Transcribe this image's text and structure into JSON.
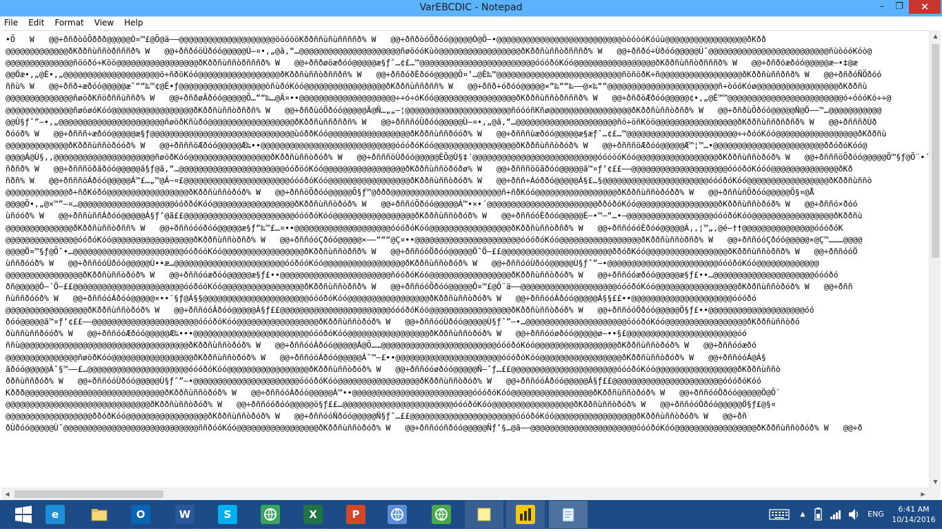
{
  "window": {
    "title": "VarEBCDIC - Notepad",
    "minimize": "–",
    "maximize": "❐",
    "close": "✕"
  },
  "menu": [
    "File",
    "Edit",
    "Format",
    "View",
    "Help"
  ],
  "editor_lines": [
    "•Õ   W   @@÷ðñðòôÕððð@@@@@Ò¤™£@Õ@ä——@@@@@@@@@@@@@@@@@@@@ööóööKððññùñùññññð% W   @@÷ðñðòóÕðóó@@@@@Ò@Õ–•@@@@@@@@@@@@@@@@@@@@@@@@@@òòóòóKóúù@@@@@@@@@@@@@@@@@ðKðð",
    "@@@@@@@@@@@@@ðKððñùññòðñññð% W   @@÷ðñðóöÙðóó@@@@@Ù–¤•,„@ã,“…@@@@@@@@@@@@@@@@@@@@@ñøöóóKùò@@@@@@@@@@@@@@@@@ðKððñùññòðñññð% W   @@÷ðñðó÷Ùðóó@@@@@Ùˆ@@@@@@@@@@@@@@@@@@@@@@@@@ñùòóóKóò@",
    "@@@@@@@@@@@@@@ñööðó÷Köö@@@@@@@@@@@@@@@@@ðKððñùññòðñññð% W   @@÷ðñðøöæðóó@@@@@æ§ƒˆ…¢£…™@@@@@@@@@@@@@@@@@@@@@@@@óóóðóKóó@@@@@@@@@@@@@@@@@ðKððñùññòðñññð% W   @@÷ðñðóæðóó@@@@@æ–•‡@æ",
    "@@Öæ•,„@È•,„@@@@@@@@@@@@@@@@@@@@ö÷ñðöKóó@@@@@@@@@@@@@@@@@ðKððñùññòðññðñ% W   @@÷ðñðóðÈðóó@@@@@Õ¤’…@È‰™@@@@@@@@@@@@@@@@@@@@@@@@@@ñöñöðK÷ñ@@@@@@@@@@@@@@@@@ðKððñùññðñð% W   @@÷ðñðóÑÕðóó",
    "ññù% W   @@÷ðñð÷æðóó@@@@@æˆ““‰™¢@É•ƒ@@@@@@@@@@@@@@@@@@òñùðóKóó@@@@@@@@@@@@@@@@@ðKððñùññðññ% W   @@÷ðñð÷óðóó@@@@@×“‰““‰——@×‰““@@@@@@@@@@@@@@@@@@@@@@@ñ÷òóóKóø@@@@@@@@@@@@@@@@@ðKððñù",
    "@@@@@@@@@@@@@@ñøöðKñöðññùññð% W   @@÷ðñðøÄðóó@@@@@Õ…““‰…@Ä¤••@@@@@@@@@@@@@@@@@@@@÷÷ó÷óKóó@@@@@@@@@@@@@@@@@ðKððñùññòðñññð% W   @@÷ðñðöÆðóó@@@@@¢•,„@É™™@@@@@@@@@@@@@@@@@@@@@@@@ó÷óóóKó÷÷@",
    "@@@@@@@@@@@@@@ñøöøóKóó@@@@@@@@@@@@@@@@@ðKððñùññòðñðñ% W   @@÷ðñðùóÕðóó@@@@@Ã@Ñ…„„—¦@@@@@@@@@@@@@@@@@@@@@@ñóóóñKñø@@@@@@@@@@@@@@@@@ðKððñùññòðñð% W   @@÷ðñðùÕðóó@@@@@Ñ@Ö——™…@@@@@@@@@@@",
    "@@Ù§ƒˆ”—•,„@@@@@@@@@@@@@@@@@@@@@@ñøöðKñùðó@@@@@@@@@@@@@@@@@@ðKððñùññðñðñ% W   @@÷ðñññóÙðóó@@@@@Ù–¤•,„@ã,“…@@@@@@@@@@@@@@@@@@@@@ñö÷öñKöö@@@@@@@@@@@@@@@@@ðKððñùññðñðñð% W   @@÷ðñññðÙð",
    "ðóóð% W   @@÷ðñññ÷æðóó@@@@@æ§ƒ@@@@@@@@@@@@@@@@@@@@@@@@@@@@@@ùóððKóó@@@@@@@@@@@@@@@@@ðKððñùññðóóð% W   @@÷ðñññùæðóó@@@@@æ§æƒˆ…¢£…™@@@@@@@@@@@@@@@@@@@@@@@÷÷ðóóKóó@@@@@@@@@@@@@@@@@ðKððñù",
    "@@@@@@@@@@@@@ðKððñùññòðóóð% W   @@÷ðñññöÆðóó@@@@@Æ‰••@@@@@@@@@@@@@@@@@@@@@@@@@@@@óóóðóKóó@@@@@@@@@@@@@@@@@ðKððñùññòðóð% W   @@÷ðñññöÆðóó@@@@@Æ™¦™…•@@@@@@@@@@@@@@@@@@@@@@@ððóðóKóó@",
    "@@@@Á@Ù§,,@@@@@@@@@@@@@@@@@@@@@ñøöðKóó@@@@@@@@@@@@@@@@@ðKððñùññòðóð% W   @@÷ðñññöÙðóó@@@@@ÈÕ@Ù§‡´@@@@@@@@@@@@@@@@@@@@@@@@@@óóóöóKóó@@@@@@@@@@@@@@@@@ðKððñùññòðóð% W   @@÷ðñññöÕðóó@@@@@Õ™§ƒ@Õ¨•´@",
    "ñðñð% W   @@÷ðñññöðãðóó@@@@@ã§ƒ@ã,“…@@@@@@@@@@@@@@@@@@@@@@óóðöóKóó@@@@@@@@@@@@@@@@@ðKððñùññòðóðø% W   @@÷ðñññööãðóó@@@@@ã™¤ƒ’¢££——@@@@@@@@@@@@@@@@@@@@óóóðóKóóó@@@@@@@@@@@@@@ðKð",
    "ñðñ% W   @@÷ðñññöÁðóó@@@@@Á™£…„™@Á–¤£@@@@@@@@@@@@@@@@@@@@@@óóóðóKóó@@@@@@@@@@@@@@@@@ðKððñùññòðóð% W   @@÷ðññ÷Áóððó@@@@@Á§£…§@@@@@@@@@@@@@@@@@@@@@@óóóðóKóó@@@@@@@@@@@@@@@@@ðKððñùññò",
    "@@@@@@@@@@@@@ð÷ñðKóðó@@@@@@@@@@@@@@@@@ðKððñùññòðóð% W   @@÷ðññöÕðóó@@@@@Õ§ƒ™@ððð@@@@@@@@@@@@@@@@@@@@@@@ñ÷ñðKóó@@@@@@@@@@@@@@@@@ðKððñùññòðóðð% W   @@÷ðññùñÕðóó@@@@@Õ§¤@Å",
    "@@@@Õ•,„@×™”—¤…@@@@@@@@@@@@@@@@@@@@óóððóKóó@@@@@@@@@@@@@@@@@ðKððñùññòðóð% W   @@÷ðññóÕðóó@@@@@Á™•×•´@@@@@@@@@@@@@@@@@@@@@@@ððóðóKóó@@@@@@@@@@@@@@@@@ðKððñùññòðóð% W   @@÷ðññó×ðóó",
    "ùñóóð% W   @@÷ðññùññÁðóó@@@@@Á§ƒ’@ã££@@@@@@@@@@@@@@@@@@@@@@@óóóðóKóó@@@@@@@@@@@@@@@@@ðKððñùññòðóð% W   @@÷ðññóóÈðóó@@@@@È–•™—“…•—@@@@@@@@@@@@@@@@@@óóóðóKóó@@@@@@@@@@@@@@@@@ðKððñù",
    "@@@@@@@@@@@@@@ðKððñùññòðññ% W   @@÷ðññóóóðóó@@@@@æ§ƒ“‰™£…¤••@@@@@@@@@@@@@@@@@@@@óóóðóKóó@@@@@@@@@@@@@@@@@ðKððñùññòðñð% W   @@÷ðññóóóÈðóó@@@@@Á,,¦™„,@é–††@@@@@@@@@@@@@@@óóóðóK",
    "@@@@@@@@@@@@@@@óóðóKóó@@@@@@@@@@@@@@@@@ðKððñùññòðñð% W   @@÷ðññóóÇðóó@@@@@×–—“““@Ç¤••@@@@@@@@@@@@@@@@@@@@@@óóóðóKóó@@@@@@@@@@@@@@@@@ðKððñùññòðñð% W   @@÷ðññóóÇðóó@@@@@×@Ç™………@@@@",
    "@@@@Ö¤™§ƒ@Õˆ•…@@@@@@@@@@@@@@@@@@@@@@@óóðóóKóó@@@@@@@@@@@@@@@@@ðKððñùññòðñð% W   @@÷ðññóóÖðóó@@@@@ÖˆÖ–££@@@@@@@@@@@@@@@@@@@@@@@ððóðKóó@@@@@@@@@@@@@@@@@ðKððñùññòðñð% W   @@÷ðññóóÖ",
    "ùññðóóð% W   @@÷ðññóóÙðóó@@@@@Ù••æ…@@@@@@@@@@@@@@@@@@@@@@@óóðóóKóó@@@@@@@@@@@@@@@@@ðKððñùññòðóð% W   @@÷ðññóóÙðóó@@@@@Ù§ƒˆ”—•@@@@@@@@@@@@@@@@@@@@@@@óóóðóKóó@@@@@@@@@@@@@",
    "@@@@@@@@@@@@@@@@ðKððñùññòðóð% W   @@÷ðññóóæðóó@@@@@æ§ƒ£••@@@@@@@@@@@@@@@@@@@@@@@ñóóðóKóó@@@@@@@@@@@@@@@@@ðKððñùññòðóð% W   @@÷ðññóóæðóó@@@@@æ§ƒ£••…@@@@@@@@@@@@@@@@@@@@@óóóðó",
    "ðñ@@@@@Ö–´Ö–££@@@@@@@@@@@@@@@@@@@@@@@óóðóóKóó@@@@@@@@@@@@@@@@@ðKððñùññòðñð% W   @@÷ðññóóÕðóó@@@@@Õ¤™£@Õ¨ä——@@@@@@@@@@@@@@@@@@@@óóóðóKóó@@@@@@@@@@@@@@@@@ðKððñùññòðóð% W   @@÷ðññ",
    "ñùññðóóð% W   @@÷ðññóóÁðóó@@@@@×••¨§ƒ@Á§§@@@@@@@@@@@@@@@@@@@@@@óóóðóKóó@@@@@@@@@@@@@@@@@ðKððñùññòðóð% W   @@÷ðññóóÁðóó@@@@@Á§§££••@@@@@@@@@@@@@@@@@@@@@óóóðó",
    "@@@@@@@@@@@@@@@@@ðKððñùññòðóð% W   @@÷ðññóóÁðóó@@@@@Á§ƒ££@@@@@@@@@@@@@@@@@@@@@@@óóóðóKóó@@@@@@@@@@@@@@@@@ðKððñùññòðóð% W   @@÷ðññóóÖðóó@@@@@Ö§ƒ£••@@@@@@@@@@@@@@@@@@@@óó",
    "ðóó@@@@@ã™¤ƒ’¢££——@@@@@@@@@@@@@@@@@@@@@@óóóðóKóó@@@@@@@@@@@@@@@@@ðKððñùññòðóð% W   @@÷ðññóóÙðóó@@@@@Ù§ƒˆ”—•…@@@@@@@@@@@@@@@@@@@@@óóóðóKóó@@@@@@@@@@@@@@@@@ðKððñùññòðó",
    "ðùññùññðóóð% W   @@÷ðññóóÆðóó@@@@@Æ‰•••@@@@@@@@@@@@@@@@@@@@@@@@óóóðóKóó@@@@@@@@@@@@@@@@@ðKððñùññòðóð% W   @@÷ðññóóøðóó@@@@@ø–••§£@@@@@@@@@@@@@@@@@@@@@@@óó",
    "ññù@@@@@@@@@@@@@@@@@@@@@@@@@@@@@@@@@@@ðKððñùññòðóð% W   @@÷ðññóóÁðóó@@@@@Á@Õ……@@@@@@@@@@@@@@@@@@@@@@@@óóóðóKóó@@@@@@@@@@@@@@@@@ðKððñùññòðóð% W   @@÷ðññóóæðó",
    "@@@@@@@@@@@@@@@ñøöðKóó@@@@@@@@@@@@@@@@@ðKððñùññòðóð% W   @@÷ðññóóÁðóó@@@@@Áˆ™–£••@@@@@@@@@@@@@@@@@@@@@@óóóðóKóó@@@@@@@@@@@@@@@@@ðKððñùññòðóð% W   @@÷ðññóóÁ@Á§",
    "ãðóó@@@@@Áˆ§™–—£…@@@@@@@@@@@@@@@@@@@@@óóóðóKóó@@@@@@@@@@@@@@@@@ðKððñùññòðóð% W   @@÷ðññóóøðóó@@@@@Ñ–ˆƒ…££@@@@@@@@@@@@@@@@@@@@@@óóóðóKóó@@@@@@@@@@@@@@@@@ðKððñùññò",
    "ððñùññðóð% W   @@÷ðññóóÙðóó@@@@@Ù§ƒˆ”—•@@@@@@@@@@@@@@@@@@@@@@óóóðóKóó@@@@@@@@@@@@@@@@@ðKððñùññòðóð% W   @@÷ðññóóÁðóó@@@@@Á§ƒ££@@@@@@@@@@@@@@@@@@@@@@@óóóðóKóó",
    "Kððð@@@@@@@@@@@@@@@@@@@@@@@@@@@@@ðKððñùññòðóð% W   @@÷ðññóóÁðóó@@@@@Á™••@@@@@@@@@@@@@@@@@@@@@@@@@óóóðóKóó@@@@@@@@@@@@@@@@@ðKððñùññòðóð% W   @@÷ðññóóÖðóó@@@@@Ö@Õ¨",
    "@@@@@@@@@@@@@@@@@@@@@@@@@@@@@@ðKððñùññòðóð% W   @@÷ðññóóðóó@@@@@ö§ƒ££…@@@@@@@@@@@@@@@@@@@@@@@óóóðóKóó@@@@@@@@@@@@@@@@@ðKððñùññòðóð% W   @@÷ðññóóÖðóó@@@@@Ö§ƒ£@§¤",
    "@@@@@@@@@@@@@@@@@@ððóðKóó@@@@@@@@@@@@@@@@@ðKððñùññòðóð% W   @@÷ðññóóÑðóó@@@@@Ñ§ƒˆ…££@@@@@@@@@@@@@@@@@@@@@@óóóðóKóó@@@@@@@@@@@@@@@@@ðKððñùññòðóð% W   @@÷ðñ",
    "ðÙðóó@@@@@Ùˆ@@@@@@@@@@@@@@@@@@@@@@@@@@@@ññðóóKóó@@@@@@@@@@@@@@@@@ðKððñùññòðóð% W   @@÷ðññóóñðóó@@@@@Ñƒ’§…@ã——@@@@@@@@@@@@@@@@@@@@@@óóóðóKóó@@@@@@@@@@@@@@@@@ðKððñùññòðóð% W   @@÷ð"
  ],
  "taskbar": {
    "apps": [
      {
        "name": "start",
        "label": "",
        "color": "#1d4b86"
      },
      {
        "name": "internet-explorer",
        "label": "e",
        "color": "#1c8fd6"
      },
      {
        "name": "file-explorer",
        "label": "",
        "color": "#e8c25a"
      },
      {
        "name": "outlook",
        "label": "O",
        "color": "#0a64b4"
      },
      {
        "name": "word",
        "label": "W",
        "color": "#2b579a"
      },
      {
        "name": "skype",
        "label": "S",
        "color": "#00aff0"
      },
      {
        "name": "globe",
        "label": "",
        "color": "#3aa35d"
      },
      {
        "name": "excel",
        "label": "X",
        "color": "#217346"
      },
      {
        "name": "powerpoint",
        "label": "P",
        "color": "#d24726"
      },
      {
        "name": "network",
        "label": "",
        "color": "#5a8fd6"
      },
      {
        "name": "downloader",
        "label": "",
        "color": "#4aa84a"
      },
      {
        "name": "sticky-notes",
        "label": "",
        "color": "#f2e37a"
      },
      {
        "name": "power-bi",
        "label": "",
        "color": "#f2c811"
      },
      {
        "name": "notepad",
        "label": "",
        "color": "#a9d3ef"
      }
    ],
    "language": "ENG",
    "time": "6:41 AM",
    "date": "10/14/2016"
  }
}
